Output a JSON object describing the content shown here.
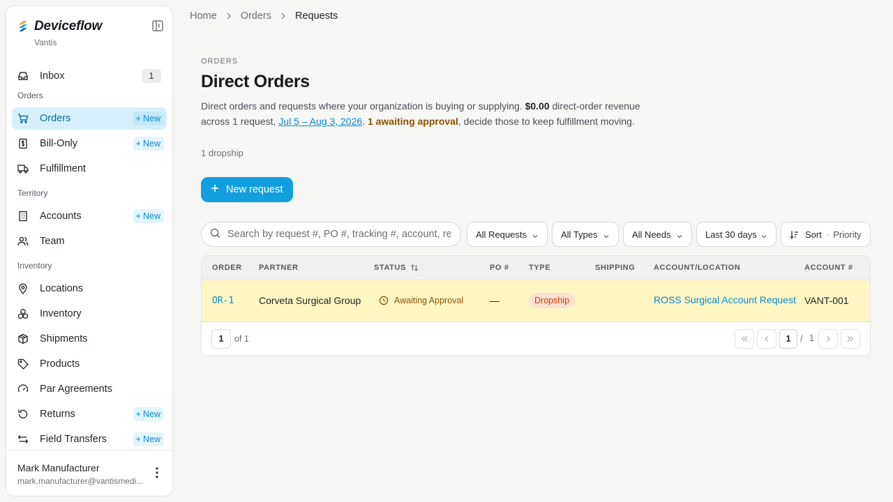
{
  "app": {
    "name": "Deviceflow",
    "org": "Vantis"
  },
  "sidebar": {
    "inbox": {
      "label": "Inbox",
      "count": "1"
    },
    "sections": {
      "orders": "Orders",
      "territory": "Territory",
      "inventory": "Inventory"
    },
    "items": {
      "orders": {
        "label": "Orders",
        "new": "New"
      },
      "bill_only": {
        "label": "Bill-Only",
        "new": "New"
      },
      "fulfillment": {
        "label": "Fulfillment"
      },
      "accounts": {
        "label": "Accounts",
        "new": "New"
      },
      "team": {
        "label": "Team"
      },
      "locations": {
        "label": "Locations"
      },
      "inventory": {
        "label": "Inventory"
      },
      "shipments": {
        "label": "Shipments"
      },
      "products": {
        "label": "Products"
      },
      "par_agreements": {
        "label": "Par Agreements"
      },
      "returns": {
        "label": "Returns",
        "new": "New"
      },
      "field_transfers": {
        "label": "Field Transfers",
        "new": "New"
      }
    },
    "user": {
      "name": "Mark Manufacturer",
      "email": "mark.manufacturer@vantismedi..."
    }
  },
  "breadcrumb": [
    "Home",
    "Orders",
    "Requests"
  ],
  "header": {
    "eyebrow": "ORDERS",
    "title": "Direct Orders",
    "desc_1": "Direct orders and requests where your organization is buying or supplying. ",
    "revenue": "$0.00",
    "desc_2": " direct-order revenue across 1 request, ",
    "date_range": "Jul 5 – Aug 3, 2026",
    "desc_3": ". ",
    "awaiting": "1 awaiting approval",
    "desc_4": ", decide those to keep fulfillment moving.",
    "subnote": "1 dropship"
  },
  "new_request_label": "New request",
  "search": {
    "placeholder": "Search by request #, PO #, tracking #, account, rep, ..."
  },
  "filters": {
    "requests": "All Requests",
    "types": "All Types",
    "needs": "All Needs",
    "period": "Last 30 days",
    "sort_label": "Sort",
    "sort_value": "Priority"
  },
  "table": {
    "columns": [
      "ORDER",
      "PARTNER",
      "STATUS",
      "PO #",
      "TYPE",
      "SHIPPING",
      "ACCOUNT/LOCATION",
      "ACCOUNT #"
    ],
    "rows": [
      {
        "order": "OR-1",
        "partner": "Corveta Surgical Group",
        "status": "Awaiting Approval",
        "po": "—",
        "type": "Dropship",
        "shipping": "",
        "account_location": "ROSS Surgical Account Request",
        "account_no": "VANT-001"
      }
    ],
    "footer": {
      "page": "1",
      "of": "of 1",
      "current": "1",
      "slash": "/",
      "total": "1"
    }
  },
  "colors": {
    "accent": "#119fe0",
    "active_bg": "#d6f0fb",
    "row_highlight": "#fdf6c3",
    "warn": "#8a5300",
    "dropship": "#c2410c"
  }
}
